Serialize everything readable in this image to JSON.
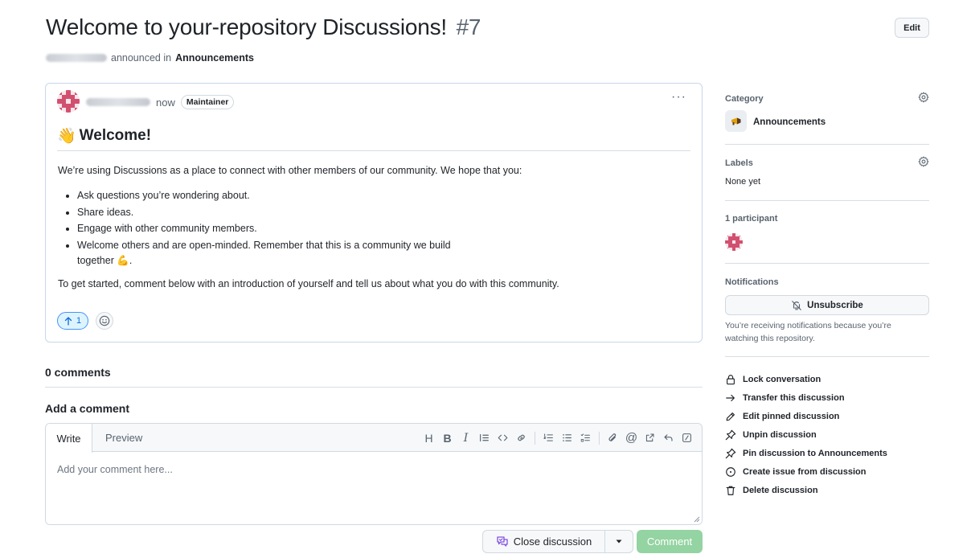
{
  "header": {
    "title": "Welcome to your-repository Discussions!",
    "number": "#7",
    "edit_label": "Edit",
    "announced_text": "announced in",
    "category_link": "Announcements"
  },
  "post": {
    "time": "now",
    "role_badge": "Maintainer",
    "more_label": "···",
    "heading_emoji": "👋",
    "heading": "Welcome!",
    "intro": "We’re using Discussions as a place to connect with other members of our community. We hope that you:",
    "bullets": [
      "Ask questions you’re wondering about.",
      "Share ideas.",
      "Engage with other community members.",
      "Welcome others and are open-minded. Remember that this is a community we build together 💪."
    ],
    "outro": "To get started, comment below with an introduction of yourself and tell us about what you do with this community.",
    "upvote_count": "1"
  },
  "comments": {
    "count_label": "0 comments",
    "add_heading": "Add a comment"
  },
  "editor": {
    "tab_write": "Write",
    "tab_preview": "Preview",
    "placeholder": "Add your comment here...",
    "toolbar_icons": [
      "heading-icon",
      "bold-icon",
      "italic-icon",
      "quote-icon",
      "code-icon",
      "link-icon",
      "numbered-list-icon",
      "unordered-list-icon",
      "task-list-icon",
      "attach-icon",
      "mention-icon",
      "cross-reference-icon",
      "reply-icon",
      "slash-command-icon"
    ]
  },
  "footer_buttons": {
    "close_label": "Close discussion",
    "comment_label": "Comment"
  },
  "sidebar": {
    "category_label": "Category",
    "category_name": "Announcements",
    "labels_label": "Labels",
    "labels_value": "None yet",
    "participants_label": "1 participant",
    "notifications_label": "Notifications",
    "unsubscribe_label": "Unsubscribe",
    "notification_note": "You’re receiving notifications because you’re watching this repository.",
    "actions": [
      {
        "icon": "lock-icon",
        "label": "Lock conversation"
      },
      {
        "icon": "arrow-right-icon",
        "label": "Transfer this discussion"
      },
      {
        "icon": "pencil-icon",
        "label": "Edit pinned discussion"
      },
      {
        "icon": "pin-icon",
        "label": "Unpin discussion"
      },
      {
        "icon": "pin-icon",
        "label": "Pin discussion to Announcements"
      },
      {
        "icon": "issue-opened-icon",
        "label": "Create issue from discussion"
      },
      {
        "icon": "trash-icon",
        "label": "Delete discussion"
      }
    ]
  },
  "colors": {
    "accent_blue": "#0969da",
    "comment_button": "#94d3a2",
    "text_primary": "#1f2328",
    "text_muted": "#59636e"
  }
}
